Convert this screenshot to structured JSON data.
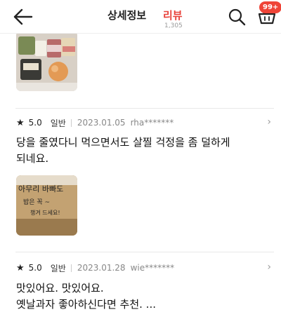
{
  "header": {
    "tab_detail": "상세정보",
    "tab_review": "리뷰",
    "review_count": "1,305",
    "cart_badge": "99+",
    "accent_color": "#e8413a"
  },
  "reviews": [
    {
      "star": "★",
      "score": "5.0",
      "type": "일반",
      "date": "2023.01.05",
      "user": "rha*******",
      "text_line1": "당을 줄였다니 먹으면서도 살찔 걱정을 좀 덜하게",
      "text_line2": "되네요."
    },
    {
      "star": "★",
      "score": "5.0",
      "type": "일반",
      "date": "2023.01.28",
      "user": "wie*******",
      "text_line1": "맛있어요. 맛있어요.",
      "text_line2": "옛날과자 좋아하신다면 추천. ..."
    }
  ],
  "photo2_text": {
    "line1": "아무리 바빠도",
    "line2": "밥은 꼭 ~",
    "line3": "챙겨 드세요!"
  }
}
